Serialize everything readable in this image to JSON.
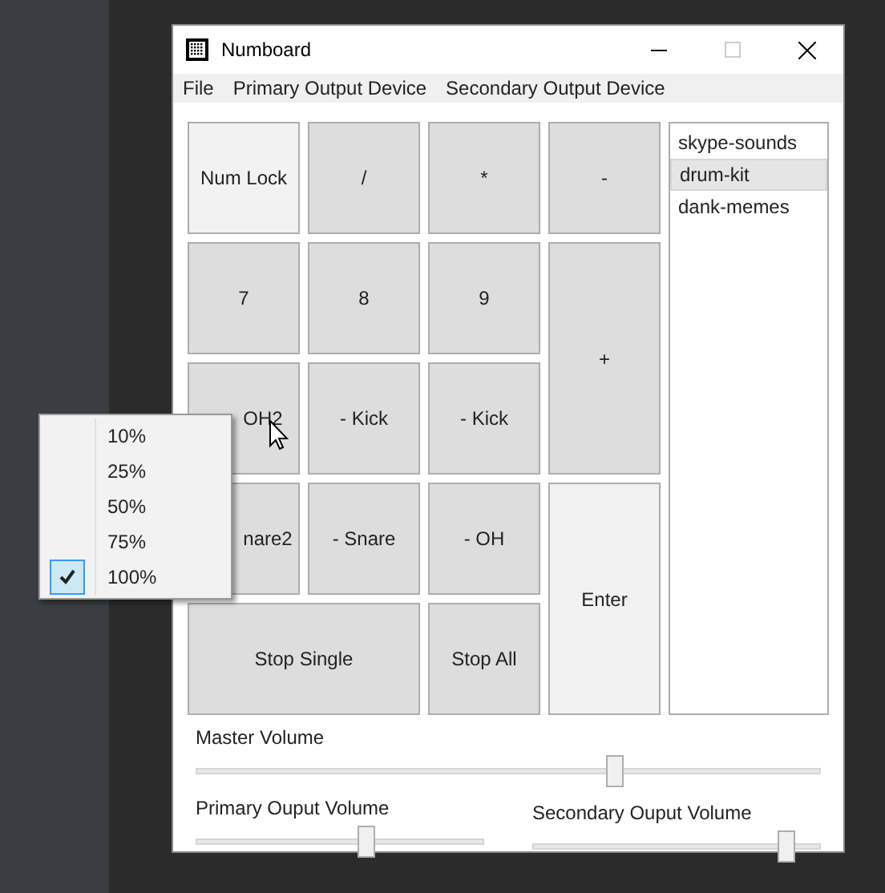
{
  "window": {
    "title": "Numboard"
  },
  "menu_bar": [
    "File",
    "Primary Output Device",
    "Secondary Output Device"
  ],
  "keys": [
    {
      "label": "Num Lock",
      "highlighted": true
    },
    {
      "label": "/",
      "highlighted": false
    },
    {
      "label": "*",
      "highlighted": false
    },
    {
      "label": "-",
      "highlighted": false
    },
    {
      "label": "7",
      "highlighted": false
    },
    {
      "label": "8",
      "highlighted": false
    },
    {
      "label": "9",
      "highlighted": false
    },
    {
      "label": "+",
      "highlighted": false
    },
    {
      "label": "OH2",
      "highlighted": false
    },
    {
      "label": "- Kick",
      "highlighted": false
    },
    {
      "label": "- Kick",
      "highlighted": false
    },
    {
      "label": "nare2",
      "highlighted": false
    },
    {
      "label": "- Snare",
      "highlighted": false
    },
    {
      "label": "- OH",
      "highlighted": false
    },
    {
      "label": "Enter",
      "highlighted": true
    },
    {
      "label": "Stop Single",
      "highlighted": false
    },
    {
      "label": "Stop All",
      "highlighted": false
    }
  ],
  "sound_packs": [
    {
      "label": "skype-sounds",
      "selected": false
    },
    {
      "label": "drum-kit",
      "selected": true
    },
    {
      "label": "dank-memes",
      "selected": false
    }
  ],
  "sliders": [
    {
      "label": "Master Volume",
      "level": 0.67
    },
    {
      "label": "Primary Ouput Volume",
      "level": 0.59
    },
    {
      "label": "Secondary Ouput Volume",
      "level": 0.88
    }
  ],
  "context_menu": [
    {
      "label": "10%",
      "checked": false
    },
    {
      "label": "25%",
      "checked": false
    },
    {
      "label": "50%",
      "checked": false
    },
    {
      "label": "75%",
      "checked": false
    },
    {
      "label": "100%",
      "checked": true
    }
  ]
}
